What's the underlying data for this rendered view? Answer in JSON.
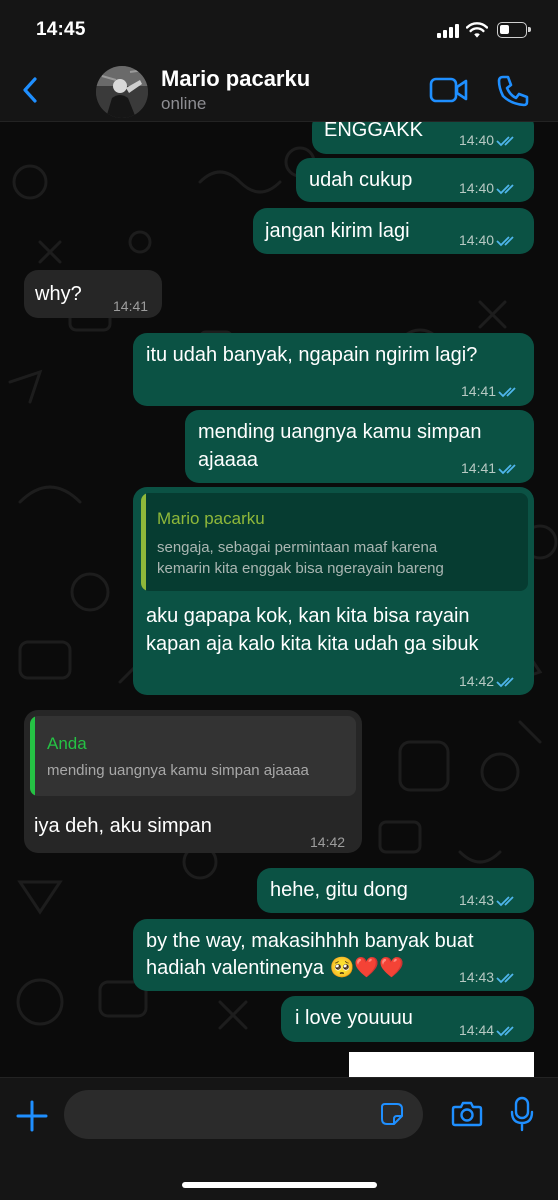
{
  "status_bar": {
    "time": "14:45"
  },
  "header": {
    "contact_name": "Mario pacarku",
    "contact_status": "online"
  },
  "messages": [
    {
      "direction": "out",
      "text": "ENGGAKK",
      "time": "14:40",
      "read": true
    },
    {
      "direction": "out",
      "text": "udah cukup",
      "time": "14:40",
      "read": true
    },
    {
      "direction": "out",
      "text": "jangan kirim lagi",
      "time": "14:40",
      "read": true
    },
    {
      "direction": "in",
      "text": "why?",
      "time": "14:41"
    },
    {
      "direction": "out",
      "text": "itu udah banyak, ngapain ngirim lagi?",
      "time": "14:41",
      "read": true
    },
    {
      "direction": "out",
      "lines": [
        "mending uangnya kamu simpan",
        "ajaaaa"
      ],
      "time": "14:41",
      "read": true
    },
    {
      "direction": "out",
      "quote": {
        "author": "Mario pacarku",
        "lines": [
          "sengaja, sebagai permintaan maaf karena",
          "kemarin kita enggak bisa ngerayain bareng"
        ]
      },
      "lines": [
        "aku gapapa kok, kan kita bisa rayain",
        "kapan aja kalo kita kita udah ga sibuk"
      ],
      "time": "14:42",
      "read": true
    },
    {
      "direction": "in",
      "quote": {
        "author": "Anda",
        "text": "mending uangnya kamu simpan ajaaaa"
      },
      "text": "iya deh, aku simpan",
      "time": "14:42"
    },
    {
      "direction": "out",
      "text": "hehe, gitu dong",
      "time": "14:43",
      "read": true
    },
    {
      "direction": "out",
      "lines": [
        "by the way, makasihhhh banyak buat",
        "hadiah valentinenya 🥺❤️❤️"
      ],
      "time": "14:43",
      "read": true
    },
    {
      "direction": "out",
      "text": "i love youuuu",
      "time": "14:44",
      "read": true
    }
  ],
  "colors": {
    "accent": "#1f8fff",
    "outgoing_bubble": "#0b5244",
    "incoming_bubble": "#262626",
    "quote_green": "#25c244",
    "quote_olive": "#8fb83a",
    "read_ticks": "#4fb6ec"
  },
  "icons": {
    "back": "chevron-left-icon",
    "video": "video-camera-icon",
    "call": "phone-icon",
    "plus": "plus-icon",
    "sticker": "sticker-icon",
    "camera": "camera-icon",
    "mic": "microphone-icon"
  }
}
